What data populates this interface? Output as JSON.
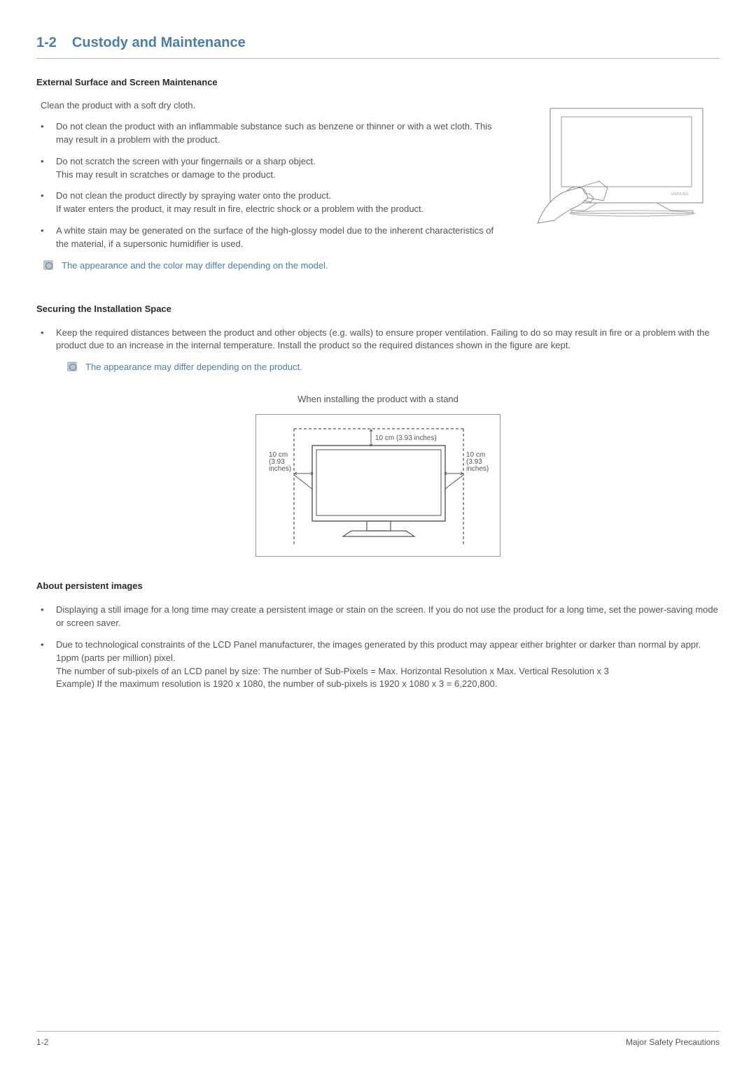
{
  "heading": {
    "num": "1-2",
    "title": "Custody and Maintenance"
  },
  "sec1": {
    "title": "External Surface and Screen Maintenance",
    "intro": "Clean the product with a soft dry cloth.",
    "b1a": "Do not clean the product with an inflammable substance such as benzene or thinner or with a wet cloth. This may result in a problem with the product.",
    "b2a": "Do not scratch the screen with your fingernails or a sharp object.",
    "b2b": "This may result in scratches or damage to the product.",
    "b3a": "Do not clean the product directly by spraying water onto the product.",
    "b3b": "If water enters the product, it may result in fire, electric shock or a problem with the product.",
    "b4a": "A white stain may be generated on the surface of the high-glossy model due to the inherent characteristics of the material, if a supersonic humidifier is used.",
    "note": "The appearance and the color may differ depending on the model."
  },
  "sec2": {
    "title": "Securing the Installation Space",
    "b1a": "Keep the required distances between the product and other objects (e.g. walls) to ensure proper ventilation. Failing to do so may result in fire or a problem with the product due to an increase in the internal temperature. Install the product so the required distances shown in the figure are kept.",
    "note": "The appearance may differ depending on the product.",
    "caption": "When installing the product with a stand",
    "dim_top": "10 cm (3.93 inches)",
    "dim_left_a": "10 cm",
    "dim_left_b": "(3.93",
    "dim_left_c": "inches)",
    "dim_right_a": "10 cm",
    "dim_right_b": "(3.93",
    "dim_right_c": "inches)"
  },
  "sec3": {
    "title": "About persistent images",
    "b1": "Displaying a still image for a long time may create a persistent image or stain on the screen. If you do not use the product for a long time, set the power-saving mode or screen saver.",
    "b2a": "Due to technological constraints of the LCD Panel manufacturer, the images generated by this product may appear either brighter or darker than normal by appr. 1ppm (parts per million) pixel.",
    "b2b": "The number of sub-pixels of an LCD panel by size:  The number of Sub-Pixels = Max. Horizontal Resolution x Max. Vertical Resolution x 3",
    "b2c": "Example) If the maximum resolution is 1920 x 1080, the number of sub-pixels is 1920 x 1080 x 3 = 6,220,800."
  },
  "footer": {
    "left": "1-2",
    "right": "Major Safety Precautions"
  }
}
